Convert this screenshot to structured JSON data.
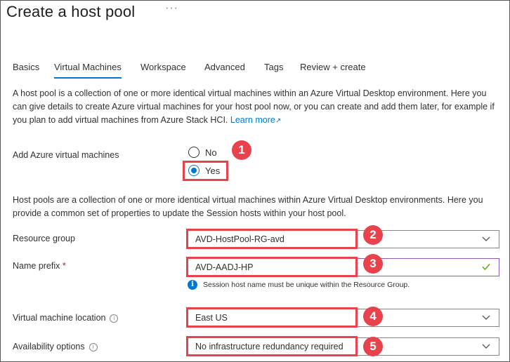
{
  "header": {
    "title": "Create a host pool",
    "more": "···"
  },
  "tabs": [
    {
      "label": "Basics",
      "active": false
    },
    {
      "label": "Virtual Machines",
      "active": true
    },
    {
      "label": "Workspace",
      "active": false
    },
    {
      "label": "Advanced",
      "active": false
    },
    {
      "label": "Tags",
      "active": false
    },
    {
      "label": "Review + create",
      "active": false
    }
  ],
  "intro": {
    "text": "A host pool is a collection of one or more identical virtual machines within an Azure Virtual Desktop environment. Here you can give details to create Azure virtual machines for your host pool now, or you can create and add them later, for example if you plan to add virtual machines from Azure Stack HCI.",
    "link": "Learn more"
  },
  "add_vms": {
    "label": "Add Azure virtual machines",
    "options": [
      "No",
      "Yes"
    ],
    "selected": "Yes"
  },
  "host_desc": "Host pools are a collection of one or more identical virtual machines within Azure Virtual Desktop environments. Here you provide a common set of properties to update the Session hosts within your host pool.",
  "fields": {
    "resource_group": {
      "label": "Resource group",
      "value": "AVD-HostPool-RG-avd"
    },
    "name_prefix": {
      "label": "Name prefix",
      "required": "*",
      "value": "AVD-AADJ-HP",
      "hint": "Session host name must be unique within the Resource Group."
    },
    "vm_location": {
      "label": "Virtual machine location",
      "value": "East US"
    },
    "availability": {
      "label": "Availability options",
      "value": "No infrastructure redundancy required"
    }
  },
  "badges": [
    "1",
    "2",
    "3",
    "4",
    "5"
  ],
  "colors": {
    "accent": "#0078d4",
    "highlight": "#e8434c",
    "valid": "#8d5ab3"
  },
  "icons": {
    "chevron": "chevron-down-icon",
    "check": "checkmark-icon",
    "info": "info-icon",
    "external": "external-link-icon"
  }
}
